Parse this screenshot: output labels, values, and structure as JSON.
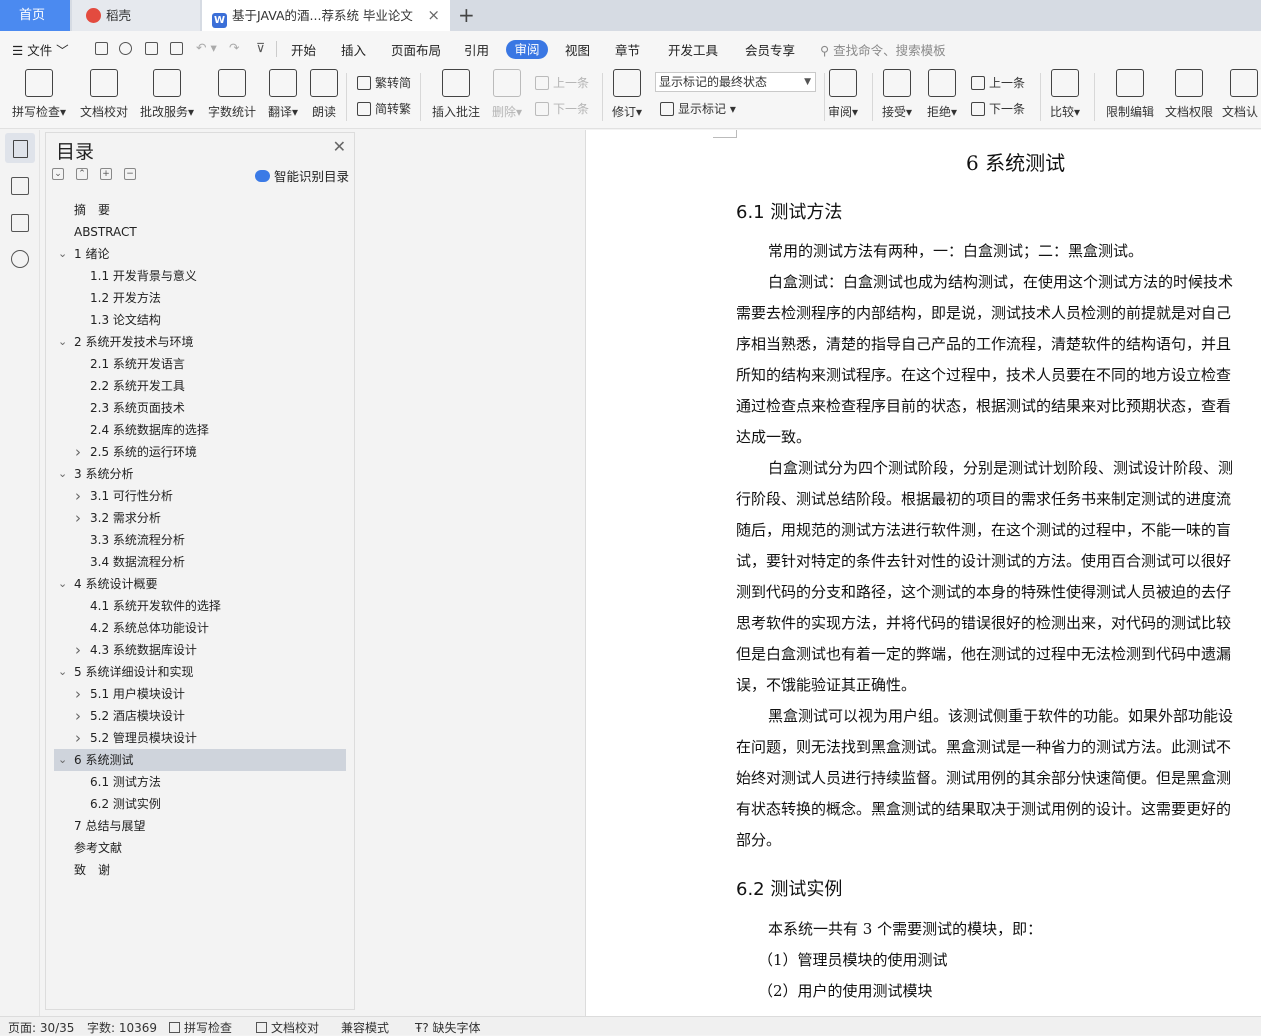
{
  "tabs": {
    "home": "首页",
    "tab1": "稻壳",
    "tab2": "基于JAVA的酒...荐系统 毕业论文",
    "close": "×",
    "new": "+"
  },
  "menu": {
    "file": "文件",
    "items": [
      "开始",
      "插入",
      "页面布局",
      "引用",
      "审阅",
      "视图",
      "章节",
      "开发工具",
      "会员专享"
    ],
    "active": "审阅",
    "search": "查找命令、搜索模板"
  },
  "ribbon": {
    "spell": "拼写检查",
    "proofread": "文档校对",
    "annotate_service": "批改服务",
    "word_count": "字数统计",
    "translate": "翻译",
    "read_aloud": "朗读",
    "trad_to_simp": "繁转简",
    "simp_to_trad": "简转繁",
    "insert_comment": "插入批注",
    "delete": "删除",
    "prev_comment": "上一条",
    "next_comment": "下一条",
    "revise": "修订",
    "markup_mode": "显示标记的最终状态",
    "show_markup": "显示标记",
    "review": "审阅",
    "accept": "接受",
    "reject": "拒绝",
    "prev_change": "上一条",
    "next_change": "下一条",
    "compare": "比较",
    "restrict": "限制编辑",
    "permissions": "文档权限",
    "certify": "文档认"
  },
  "toc": {
    "title": "目录",
    "smart": "智能识别目录",
    "items": [
      {
        "label": "摘　要",
        "level": 1,
        "caret": ""
      },
      {
        "label": "ABSTRACT",
        "level": 1,
        "caret": ""
      },
      {
        "label": "1 绪论",
        "level": 1,
        "caret": "v"
      },
      {
        "label": "1.1 开发背景与意义",
        "level": 2,
        "caret": ""
      },
      {
        "label": "1.2 开发方法",
        "level": 2,
        "caret": ""
      },
      {
        "label": "1.3 论文结构",
        "level": 2,
        "caret": ""
      },
      {
        "label": "2 系统开发技术与环境",
        "level": 1,
        "caret": "v"
      },
      {
        "label": "2.1  系统开发语言",
        "level": 2,
        "caret": ""
      },
      {
        "label": "2.2  系统开发工具",
        "level": 2,
        "caret": ""
      },
      {
        "label": "2.3  系统页面技术",
        "level": 2,
        "caret": ""
      },
      {
        "label": "2.4  系统数据库的选择",
        "level": 2,
        "caret": ""
      },
      {
        "label": "2.5  系统的运行环境",
        "level": 2,
        "caret": ">"
      },
      {
        "label": "3  系统分析",
        "level": 1,
        "caret": "v"
      },
      {
        "label": "3.1 可行性分析",
        "level": 2,
        "caret": ">"
      },
      {
        "label": "3.2 需求分析",
        "level": 2,
        "caret": ">"
      },
      {
        "label": "3.3 系统流程分析",
        "level": 2,
        "caret": ""
      },
      {
        "label": "3.4 数据流程分析",
        "level": 2,
        "caret": ""
      },
      {
        "label": "4  系统设计概要",
        "level": 1,
        "caret": "v"
      },
      {
        "label": "4.1  系统开发软件的选择",
        "level": 2,
        "caret": ""
      },
      {
        "label": "4.2  系统总体功能设计",
        "level": 2,
        "caret": ""
      },
      {
        "label": "4.3  系统数据库设计",
        "level": 2,
        "caret": ">"
      },
      {
        "label": "5  系统详细设计和实现",
        "level": 1,
        "caret": "v"
      },
      {
        "label": "5.1  用户模块设计",
        "level": 2,
        "caret": ">"
      },
      {
        "label": "5.2  酒店模块设计",
        "level": 2,
        "caret": ">"
      },
      {
        "label": "5.2  管理员模块设计",
        "level": 2,
        "caret": ">"
      },
      {
        "label": "6  系统测试",
        "level": 1,
        "caret": "v",
        "selected": true
      },
      {
        "label": "6.1  测试方法",
        "level": 2,
        "caret": ""
      },
      {
        "label": "6.2  测试实例",
        "level": 2,
        "caret": ""
      },
      {
        "label": "7  总结与展望",
        "level": 1,
        "caret": ""
      },
      {
        "label": "参考文献",
        "level": 1,
        "caret": ""
      },
      {
        "label": "致　谢",
        "level": 1,
        "caret": ""
      }
    ]
  },
  "doc": {
    "chapter": "6  系统测试",
    "sec1": "6.1  测试方法",
    "sec2": "6.2  测试实例",
    "lines1": [
      {
        "t": "常用的测试方法有两种，一：白盒测试；二：黑盒测试。",
        "indent": true
      },
      {
        "t": "白盒测试：白盒测试也成为结构测试，在使用这个测试方法的时候技术",
        "indent": true
      },
      {
        "t": "需要去检测程序的内部结构，即是说，测试技术人员检测的前提就是对自己",
        "indent": false
      },
      {
        "t": "序相当熟悉，清楚的指导自己产品的工作流程，清楚软件的结构语句，并且",
        "indent": false
      },
      {
        "t": "所知的结构来测试程序。在这个过程中，技术人员要在不同的地方设立检查",
        "indent": false
      },
      {
        "t": "通过检查点来检查程序目前的状态，根据测试的结果来对比预期状态，查看",
        "indent": false
      },
      {
        "t": "达成一致。",
        "indent": false
      },
      {
        "t": "白盒测试分为四个测试阶段，分别是测试计划阶段、测试设计阶段、测",
        "indent": true
      },
      {
        "t": "行阶段、测试总结阶段。根据最初的项目的需求任务书来制定测试的进度流",
        "indent": false
      },
      {
        "t": "随后，用规范的测试方法进行软件测，在这个测试的过程中，不能一味的盲",
        "indent": false
      },
      {
        "t": "试，要针对特定的条件去针对性的设计测试的方法。使用百合测试可以很好",
        "indent": false
      },
      {
        "t": "测到代码的分支和路径，这个测试的本身的特殊性使得测试人员被迫的去仔",
        "indent": false
      },
      {
        "t": "思考软件的实现方法，并将代码的错误很好的检测出来，对代码的测试比较",
        "indent": false
      },
      {
        "t": "但是白盒测试也有着一定的弊端，他在测试的过程中无法检测到代码中遗漏",
        "indent": false
      },
      {
        "t": "误，不饿能验证其正确性。",
        "indent": false
      },
      {
        "t": "黑盒测试可以视为用户组。该测试侧重于软件的功能。如果外部功能设",
        "indent": true
      },
      {
        "t": "在问题，则无法找到黑盒测试。黑盒测试是一种省力的测试方法。此测试不",
        "indent": false
      },
      {
        "t": "始终对测试人员进行持续监督。测试用例的其余部分快速简便。但是黑盒测",
        "indent": false
      },
      {
        "t": "有状态转换的概念。黑盒测试的结果取决于测试用例的设计。这需要更好的",
        "indent": false
      },
      {
        "t": "部分。",
        "indent": false
      }
    ],
    "lines2": [
      {
        "t": "本系统一共有 3 个需要测试的模块，即：",
        "indent": true
      },
      {
        "t": "（1）管理员模块的使用测试",
        "indent": false
      },
      {
        "t": "（2）用户的使用测试模块",
        "indent": false
      }
    ]
  },
  "status": {
    "page": "页面: 30/35",
    "words": "字数: 10369",
    "spell": "拼写检查",
    "proof": "文档校对",
    "compat": "兼容模式",
    "font": "缺失字体"
  }
}
